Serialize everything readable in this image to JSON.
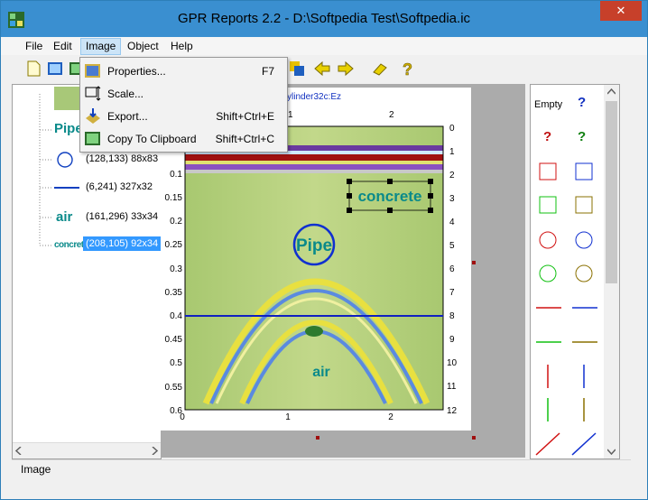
{
  "window": {
    "title": "GPR Reports 2.2 - D:\\Softpedia Test\\Softpedia.ic",
    "close_glyph": "✕"
  },
  "menubar": {
    "items": [
      "File",
      "Edit",
      "Image",
      "Object",
      "Help"
    ]
  },
  "image_menu": {
    "items": [
      {
        "label": "Properties...",
        "shortcut": "F7"
      },
      {
        "label": "Scale...",
        "shortcut": ""
      },
      {
        "label": "Export...",
        "shortcut": "Shift+Ctrl+E"
      },
      {
        "label": "Copy To Clipboard",
        "shortcut": "Shift+Ctrl+C"
      }
    ]
  },
  "tree": {
    "items": [
      {
        "label": "Pipe",
        "info": ""
      },
      {
        "label": "",
        "info": "(128,133) 88x83"
      },
      {
        "label": "",
        "info": "(6,241) 327x32"
      },
      {
        "label": "air",
        "info": "(161,296) 33x34"
      },
      {
        "label": "concrete",
        "info": "(208,105) 92x34"
      }
    ]
  },
  "plot": {
    "title_fragment": "ylinder32c:Ez",
    "left_ticks": [
      "0.1",
      "0.15",
      "0.2",
      "0.25",
      "0.3",
      "0.35",
      "0.4",
      "0.45",
      "0.5",
      "0.55",
      "0.6"
    ],
    "right_ticks": [
      "0",
      "1",
      "2",
      "3",
      "4",
      "5",
      "6",
      "7",
      "8",
      "9",
      "10",
      "11",
      "12"
    ],
    "bottom_ticks": [
      "0",
      "1",
      "2"
    ],
    "top_ticks": [
      "1",
      "2"
    ],
    "annotations": {
      "concrete": "concrete",
      "pipe": "Pipe",
      "air": "air"
    }
  },
  "palette": {
    "empty_label": "Empty",
    "question": "?"
  },
  "statusbar": {
    "text": "Image"
  }
}
